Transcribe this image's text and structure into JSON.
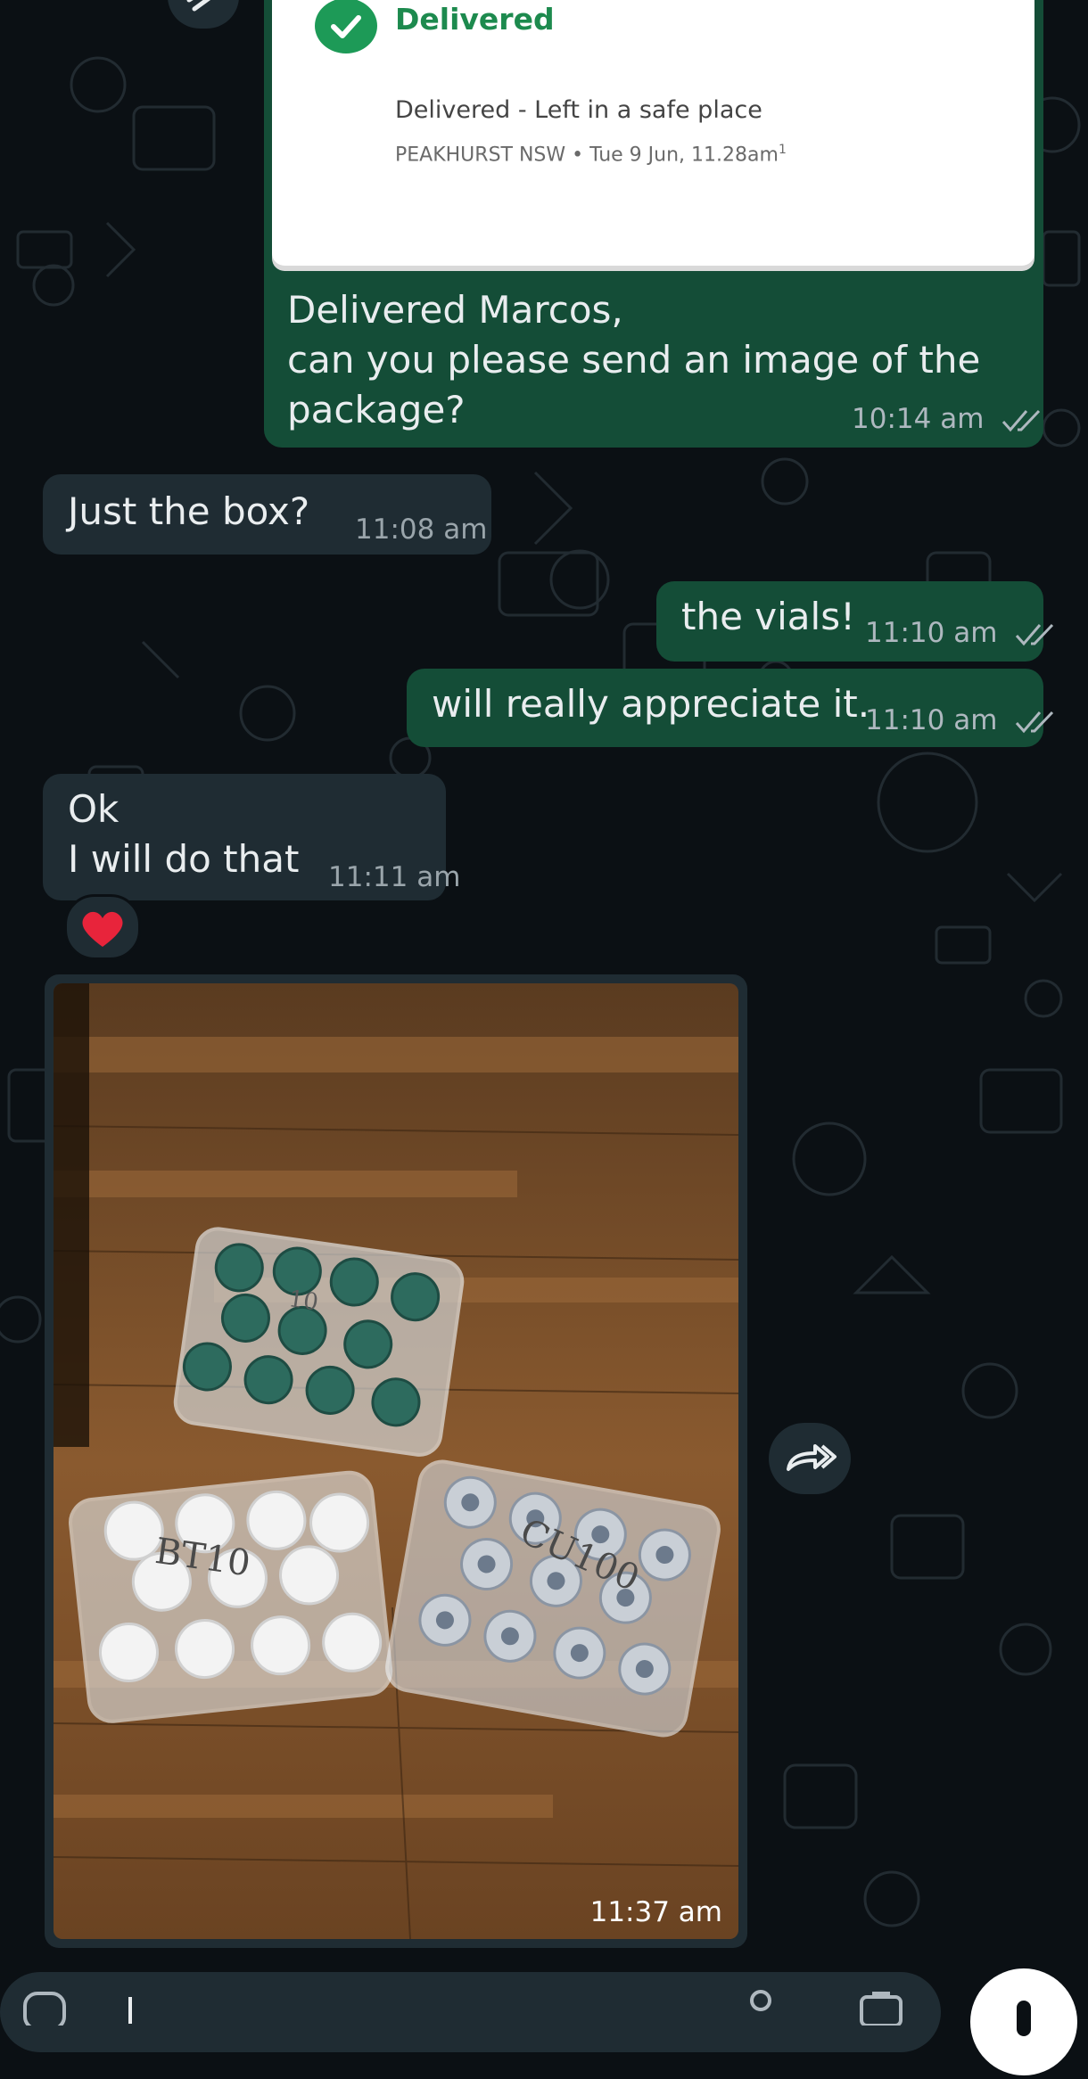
{
  "delivery_card": {
    "status": "Delivered",
    "detail": "Delivered - Left in a safe place",
    "location_time": "PEAKHURST NSW • Tue 9 Jun, 11.28am",
    "footnote": "1"
  },
  "messages": [
    {
      "direction": "outgoing",
      "text": "Delivered Marcos,\ncan you please send an image of the package?",
      "time": "10:14 am",
      "status": "read"
    },
    {
      "direction": "incoming",
      "text": "Just the box?",
      "time": "11:08 am"
    },
    {
      "direction": "outgoing",
      "text": "the vials!",
      "time": "11:10 am",
      "status": "read"
    },
    {
      "direction": "outgoing",
      "text": "will really appreciate it.",
      "time": "11:10 am",
      "status": "read"
    },
    {
      "direction": "incoming",
      "text": "Ok\nI will do that",
      "time": "11:11 am",
      "reaction": "❤️"
    },
    {
      "direction": "incoming",
      "type": "image",
      "image_description": "photo",
      "time": "11:37 am"
    }
  ],
  "photo_labels": {
    "left_box": "BT10",
    "right_box": "CU100",
    "back_box": "10"
  },
  "colors": {
    "background": "#0b1014",
    "outgoing_bubble": "#144d37",
    "incoming_bubble": "#1f2c33",
    "delivered_green": "#1d9a57"
  },
  "icons": {
    "delivered": "check-circle-icon",
    "read_status": "double-check-icon",
    "forward": "forward-icon",
    "reaction": "heart-emoji",
    "mic": "mic-icon",
    "camera": "camera-icon",
    "attach": "paperclip-icon",
    "emoji": "emoji-icon"
  }
}
